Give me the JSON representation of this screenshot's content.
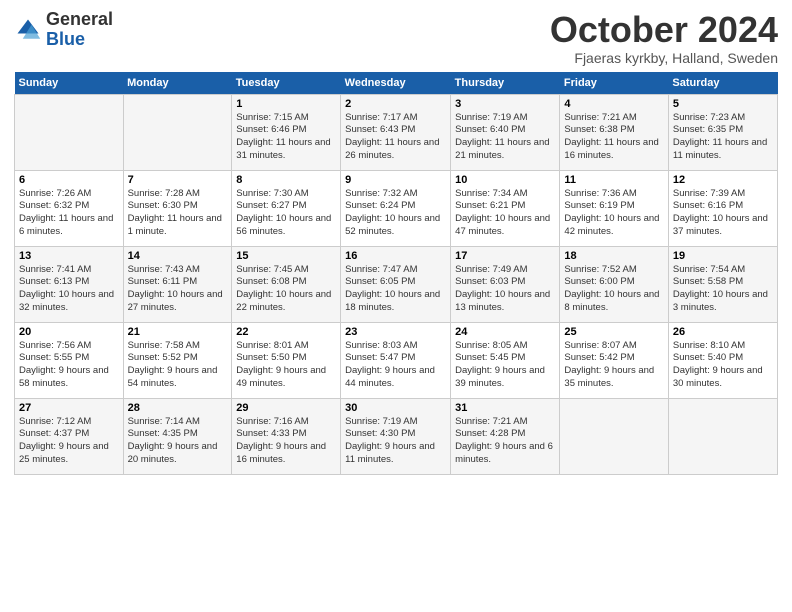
{
  "logo": {
    "general": "General",
    "blue": "Blue"
  },
  "header": {
    "month": "October 2024",
    "location": "Fjaeras kyrkby, Halland, Sweden"
  },
  "weekdays": [
    "Sunday",
    "Monday",
    "Tuesday",
    "Wednesday",
    "Thursday",
    "Friday",
    "Saturday"
  ],
  "weeks": [
    [
      null,
      null,
      {
        "day": "1",
        "sunrise": "Sunrise: 7:15 AM",
        "sunset": "Sunset: 6:46 PM",
        "daylight": "Daylight: 11 hours and 31 minutes."
      },
      {
        "day": "2",
        "sunrise": "Sunrise: 7:17 AM",
        "sunset": "Sunset: 6:43 PM",
        "daylight": "Daylight: 11 hours and 26 minutes."
      },
      {
        "day": "3",
        "sunrise": "Sunrise: 7:19 AM",
        "sunset": "Sunset: 6:40 PM",
        "daylight": "Daylight: 11 hours and 21 minutes."
      },
      {
        "day": "4",
        "sunrise": "Sunrise: 7:21 AM",
        "sunset": "Sunset: 6:38 PM",
        "daylight": "Daylight: 11 hours and 16 minutes."
      },
      {
        "day": "5",
        "sunrise": "Sunrise: 7:23 AM",
        "sunset": "Sunset: 6:35 PM",
        "daylight": "Daylight: 11 hours and 11 minutes."
      }
    ],
    [
      {
        "day": "6",
        "sunrise": "Sunrise: 7:26 AM",
        "sunset": "Sunset: 6:32 PM",
        "daylight": "Daylight: 11 hours and 6 minutes."
      },
      {
        "day": "7",
        "sunrise": "Sunrise: 7:28 AM",
        "sunset": "Sunset: 6:30 PM",
        "daylight": "Daylight: 11 hours and 1 minute."
      },
      {
        "day": "8",
        "sunrise": "Sunrise: 7:30 AM",
        "sunset": "Sunset: 6:27 PM",
        "daylight": "Daylight: 10 hours and 56 minutes."
      },
      {
        "day": "9",
        "sunrise": "Sunrise: 7:32 AM",
        "sunset": "Sunset: 6:24 PM",
        "daylight": "Daylight: 10 hours and 52 minutes."
      },
      {
        "day": "10",
        "sunrise": "Sunrise: 7:34 AM",
        "sunset": "Sunset: 6:21 PM",
        "daylight": "Daylight: 10 hours and 47 minutes."
      },
      {
        "day": "11",
        "sunrise": "Sunrise: 7:36 AM",
        "sunset": "Sunset: 6:19 PM",
        "daylight": "Daylight: 10 hours and 42 minutes."
      },
      {
        "day": "12",
        "sunrise": "Sunrise: 7:39 AM",
        "sunset": "Sunset: 6:16 PM",
        "daylight": "Daylight: 10 hours and 37 minutes."
      }
    ],
    [
      {
        "day": "13",
        "sunrise": "Sunrise: 7:41 AM",
        "sunset": "Sunset: 6:13 PM",
        "daylight": "Daylight: 10 hours and 32 minutes."
      },
      {
        "day": "14",
        "sunrise": "Sunrise: 7:43 AM",
        "sunset": "Sunset: 6:11 PM",
        "daylight": "Daylight: 10 hours and 27 minutes."
      },
      {
        "day": "15",
        "sunrise": "Sunrise: 7:45 AM",
        "sunset": "Sunset: 6:08 PM",
        "daylight": "Daylight: 10 hours and 22 minutes."
      },
      {
        "day": "16",
        "sunrise": "Sunrise: 7:47 AM",
        "sunset": "Sunset: 6:05 PM",
        "daylight": "Daylight: 10 hours and 18 minutes."
      },
      {
        "day": "17",
        "sunrise": "Sunrise: 7:49 AM",
        "sunset": "Sunset: 6:03 PM",
        "daylight": "Daylight: 10 hours and 13 minutes."
      },
      {
        "day": "18",
        "sunrise": "Sunrise: 7:52 AM",
        "sunset": "Sunset: 6:00 PM",
        "daylight": "Daylight: 10 hours and 8 minutes."
      },
      {
        "day": "19",
        "sunrise": "Sunrise: 7:54 AM",
        "sunset": "Sunset: 5:58 PM",
        "daylight": "Daylight: 10 hours and 3 minutes."
      }
    ],
    [
      {
        "day": "20",
        "sunrise": "Sunrise: 7:56 AM",
        "sunset": "Sunset: 5:55 PM",
        "daylight": "Daylight: 9 hours and 58 minutes."
      },
      {
        "day": "21",
        "sunrise": "Sunrise: 7:58 AM",
        "sunset": "Sunset: 5:52 PM",
        "daylight": "Daylight: 9 hours and 54 minutes."
      },
      {
        "day": "22",
        "sunrise": "Sunrise: 8:01 AM",
        "sunset": "Sunset: 5:50 PM",
        "daylight": "Daylight: 9 hours and 49 minutes."
      },
      {
        "day": "23",
        "sunrise": "Sunrise: 8:03 AM",
        "sunset": "Sunset: 5:47 PM",
        "daylight": "Daylight: 9 hours and 44 minutes."
      },
      {
        "day": "24",
        "sunrise": "Sunrise: 8:05 AM",
        "sunset": "Sunset: 5:45 PM",
        "daylight": "Daylight: 9 hours and 39 minutes."
      },
      {
        "day": "25",
        "sunrise": "Sunrise: 8:07 AM",
        "sunset": "Sunset: 5:42 PM",
        "daylight": "Daylight: 9 hours and 35 minutes."
      },
      {
        "day": "26",
        "sunrise": "Sunrise: 8:10 AM",
        "sunset": "Sunset: 5:40 PM",
        "daylight": "Daylight: 9 hours and 30 minutes."
      }
    ],
    [
      {
        "day": "27",
        "sunrise": "Sunrise: 7:12 AM",
        "sunset": "Sunset: 4:37 PM",
        "daylight": "Daylight: 9 hours and 25 minutes."
      },
      {
        "day": "28",
        "sunrise": "Sunrise: 7:14 AM",
        "sunset": "Sunset: 4:35 PM",
        "daylight": "Daylight: 9 hours and 20 minutes."
      },
      {
        "day": "29",
        "sunrise": "Sunrise: 7:16 AM",
        "sunset": "Sunset: 4:33 PM",
        "daylight": "Daylight: 9 hours and 16 minutes."
      },
      {
        "day": "30",
        "sunrise": "Sunrise: 7:19 AM",
        "sunset": "Sunset: 4:30 PM",
        "daylight": "Daylight: 9 hours and 11 minutes."
      },
      {
        "day": "31",
        "sunrise": "Sunrise: 7:21 AM",
        "sunset": "Sunset: 4:28 PM",
        "daylight": "Daylight: 9 hours and 6 minutes."
      },
      null,
      null
    ]
  ]
}
